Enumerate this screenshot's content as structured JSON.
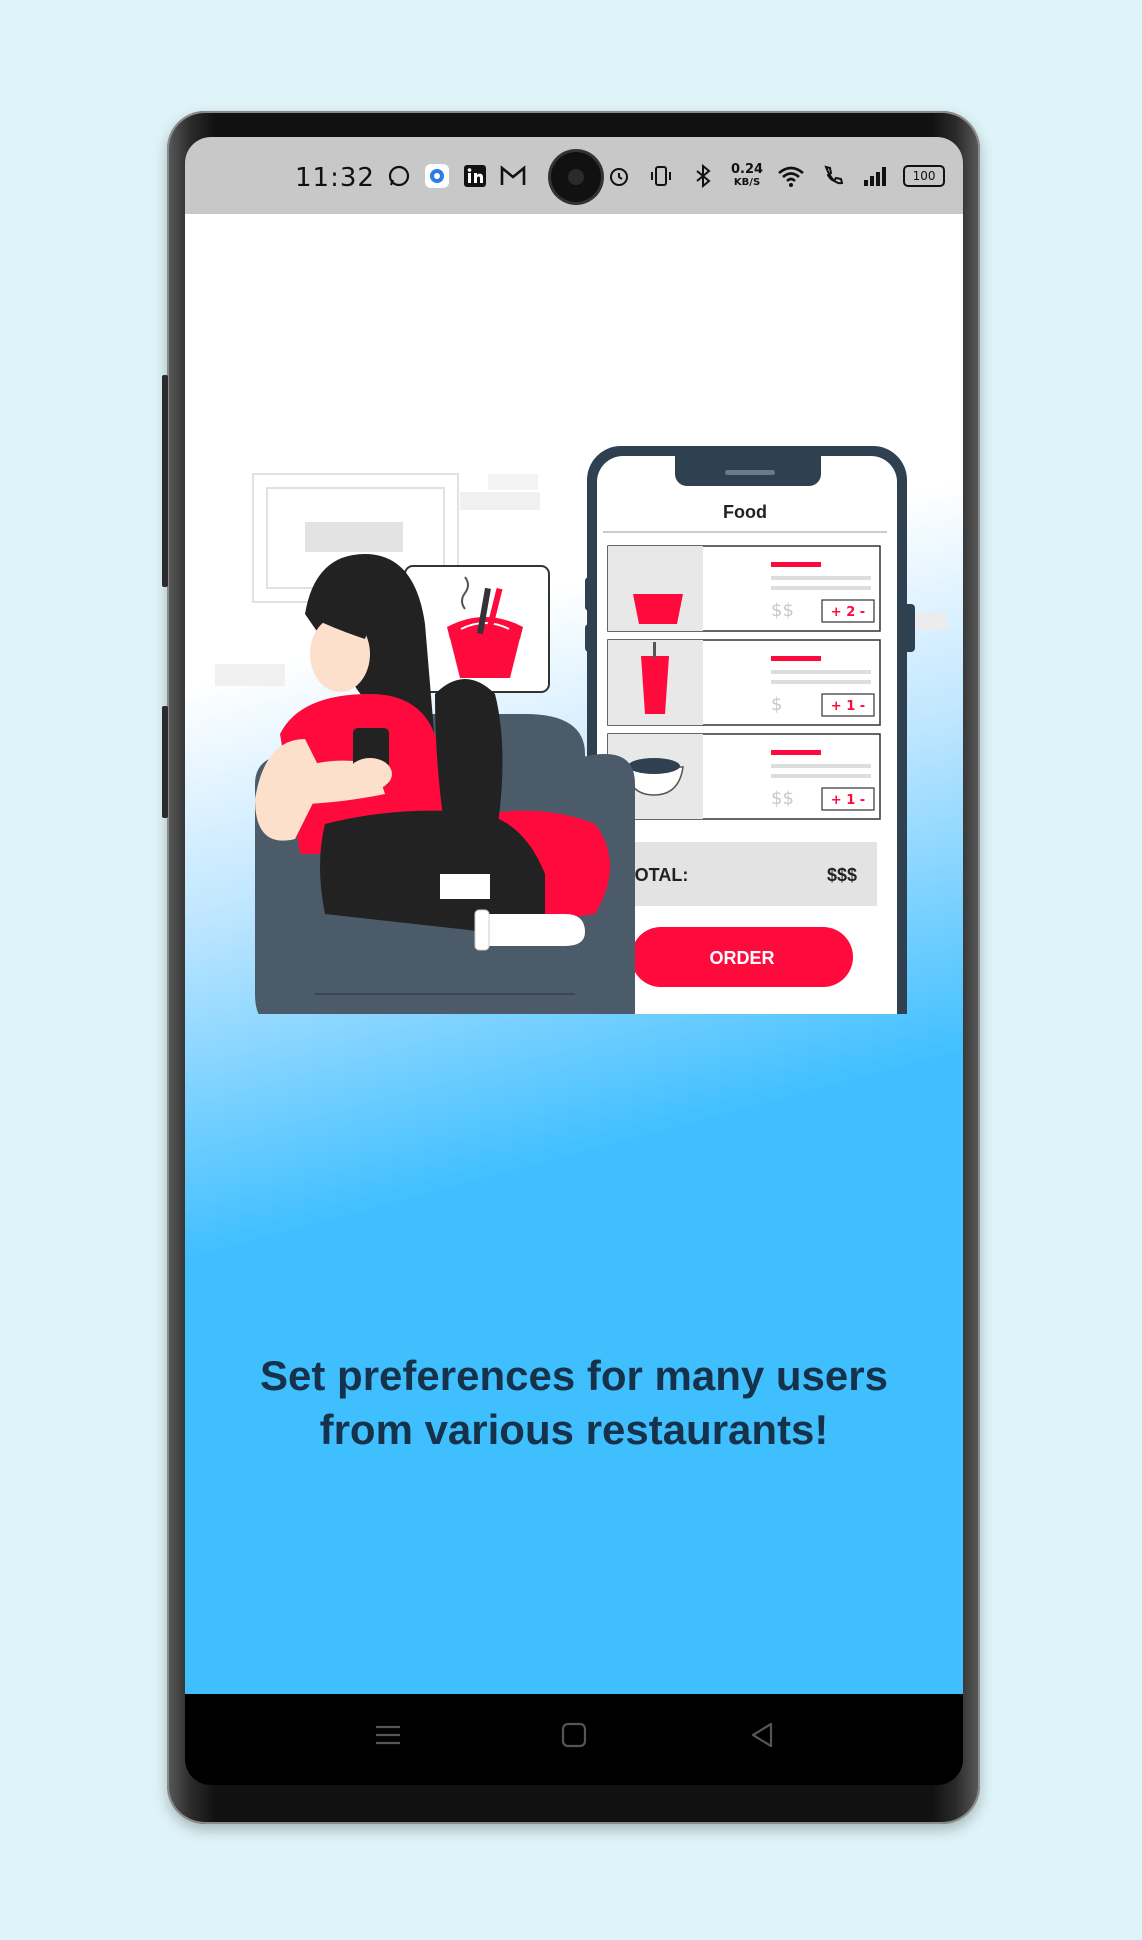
{
  "statusbar": {
    "time": "11:32",
    "net_speed_value": "0.24",
    "net_speed_unit": "KB/S",
    "battery": "100",
    "icons_left": [
      "whatsapp-icon",
      "browser-icon",
      "linkedin-icon",
      "gmail-icon"
    ],
    "icons_right": [
      "alarm-icon",
      "vibrate-icon",
      "bluetooth-icon",
      "wifi-icon",
      "call-icon",
      "signal-icon"
    ]
  },
  "illustration": {
    "phone_header": "Food",
    "items": [
      {
        "price": "$$",
        "qty": "+ 2 -"
      },
      {
        "price": "$",
        "qty": "+ 1 -"
      },
      {
        "price": "$$",
        "qty": "+ 1 -"
      }
    ],
    "total_label": "TOTAL:",
    "total_value": "$$$",
    "order_button": "ORDER"
  },
  "onboarding": {
    "headline_line1": "Set preferences for many users",
    "headline_line2": "from various restaurants!",
    "page_count": 3,
    "active_page": 2
  },
  "colors": {
    "accent_red": "#ff0a3c",
    "sky_blue": "#40bfff",
    "headline": "#16324a"
  },
  "navbar": {
    "icons": [
      "menu-icon",
      "home-icon",
      "back-icon"
    ]
  }
}
